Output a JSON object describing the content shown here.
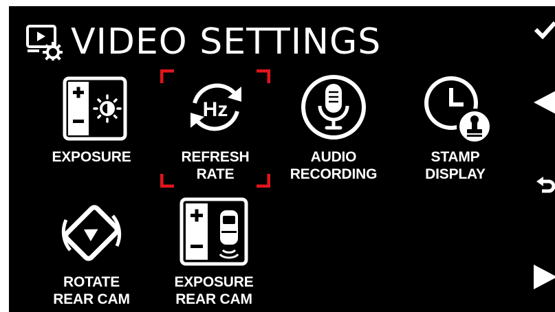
{
  "header": {
    "title": "VIDEO SETTINGS",
    "icon": "video-settings-icon"
  },
  "menu": {
    "items": [
      {
        "label": "EXPOSURE",
        "icon": "exposure-icon"
      },
      {
        "label": "REFRESH\nRATE",
        "icon": "refresh-rate-icon",
        "icon_text": "Hz",
        "selected": true
      },
      {
        "label": "AUDIO\nRECORDING",
        "icon": "microphone-icon"
      },
      {
        "label": "STAMP\nDISPLAY",
        "icon": "clock-stamp-icon"
      },
      {
        "label": "ROTATE\nREAR CAM",
        "icon": "rotate-icon"
      },
      {
        "label": "EXPOSURE\nREAR CAM",
        "icon": "exposure-rear-cam-icon"
      }
    ]
  },
  "sidebar": {
    "buttons": [
      {
        "name": "confirm",
        "icon": "checkmark-icon"
      },
      {
        "name": "previous",
        "icon": "left-arrow-icon"
      },
      {
        "name": "back",
        "icon": "return-icon"
      },
      {
        "name": "next",
        "icon": "right-arrow-icon"
      }
    ]
  },
  "colors": {
    "background": "#000000",
    "foreground": "#ffffff",
    "selection": "#e0151b"
  }
}
